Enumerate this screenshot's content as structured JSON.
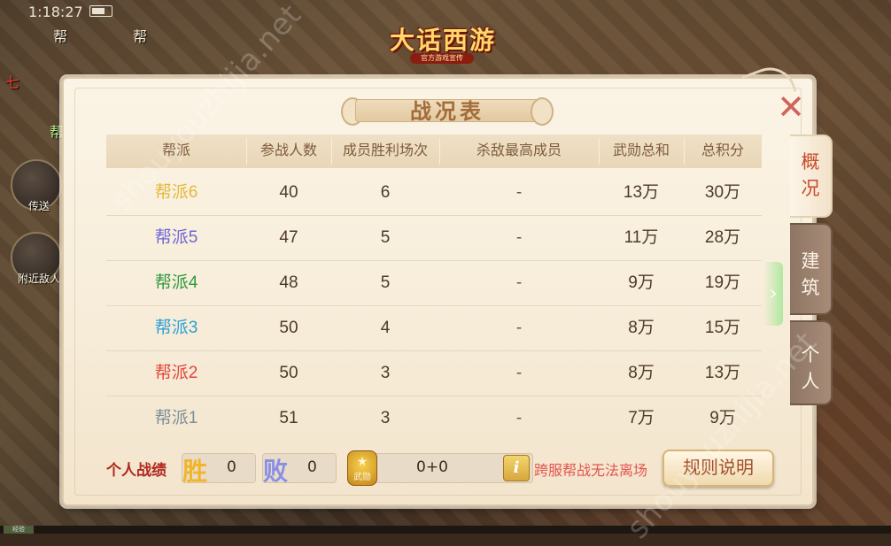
{
  "status_bar": {
    "time": "1:18:27"
  },
  "game": {
    "logo": "大话西游",
    "logo_sub": "官方游戏宣传"
  },
  "hud": {
    "chars": [
      "帮",
      "帮",
      "七",
      "帮"
    ],
    "buttons": [
      {
        "label": "传送",
        "icon": "teleport-icon"
      },
      {
        "label": "附近敌人",
        "icon": "nearby-enemy-icon"
      }
    ],
    "bottom_tag": "经验"
  },
  "watermark": "shouyouzhijia.net",
  "panel": {
    "title": "战况表",
    "close_icon": "close-icon"
  },
  "table": {
    "headers": [
      "帮派",
      "参战人数",
      "成员胜利场次",
      "杀敌最高成员",
      "武勋总和",
      "总积分"
    ],
    "rows": [
      {
        "name": "帮派6",
        "color": "#e4b93a",
        "participants": "40",
        "wins": "6",
        "top_killer": "-",
        "wuxun": "13万",
        "score": "30万"
      },
      {
        "name": "帮派5",
        "color": "#6e66d4",
        "participants": "47",
        "wins": "5",
        "top_killer": "-",
        "wuxun": "11万",
        "score": "28万"
      },
      {
        "name": "帮派4",
        "color": "#2f9a3e",
        "participants": "48",
        "wins": "5",
        "top_killer": "-",
        "wuxun": "9万",
        "score": "19万"
      },
      {
        "name": "帮派3",
        "color": "#2a9fd6",
        "participants": "50",
        "wins": "4",
        "top_killer": "-",
        "wuxun": "8万",
        "score": "15万"
      },
      {
        "name": "帮派2",
        "color": "#e0463c",
        "participants": "50",
        "wins": "3",
        "top_killer": "-",
        "wuxun": "8万",
        "score": "13万"
      },
      {
        "name": "帮派1",
        "color": "#7e8e96",
        "participants": "51",
        "wins": "3",
        "top_killer": "-",
        "wuxun": "7万",
        "score": "9万"
      }
    ]
  },
  "footer": {
    "personal_label": "个人战绩",
    "win_glyph": "胜",
    "win_color": "#f2b52a",
    "wins": "0",
    "loss_glyph": "败",
    "loss_color": "#8a8ee6",
    "losses": "0",
    "medal_label": "武勋",
    "medal_value": "0+0",
    "info_glyph": "i",
    "cross_server_note": "跨服帮战无法离场",
    "rules_button": "规则说明"
  },
  "side_tabs": [
    {
      "label_chars": [
        "概",
        "况"
      ],
      "active": true
    },
    {
      "label_chars": [
        "建",
        "筑"
      ],
      "active": false
    },
    {
      "label_chars": [
        "个",
        "人"
      ],
      "active": false
    }
  ],
  "side_arrow": "›"
}
